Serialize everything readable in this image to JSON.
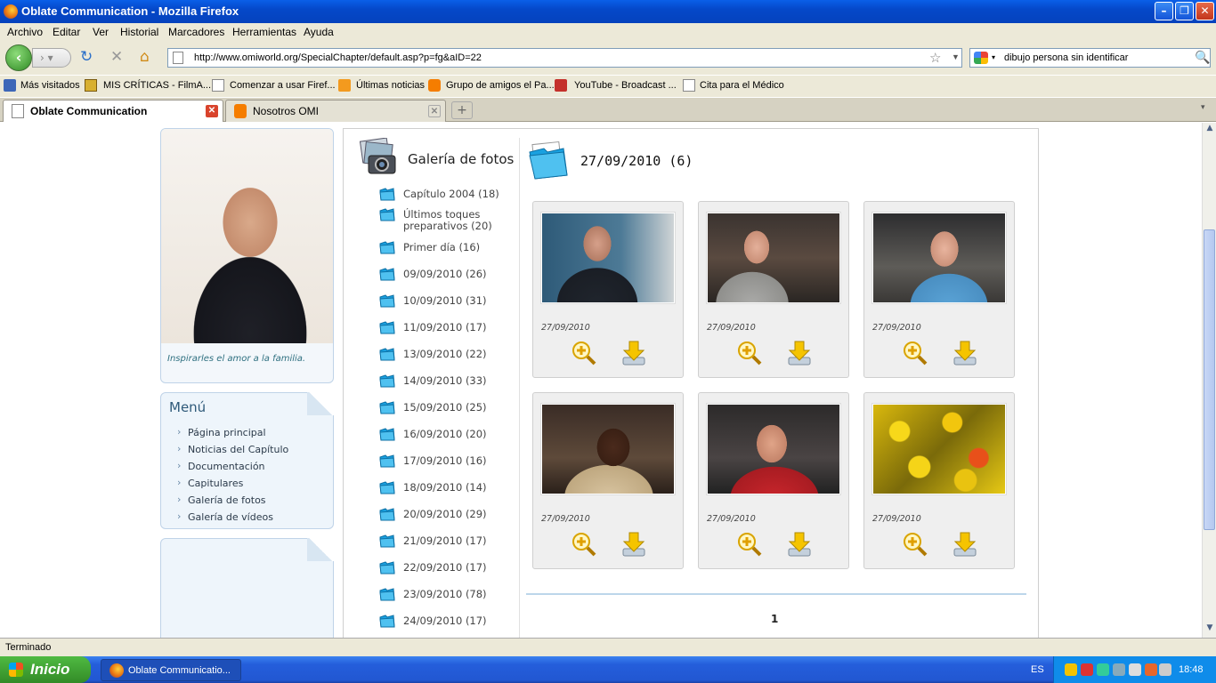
{
  "window": {
    "title": "Oblate Communication - Mozilla Firefox"
  },
  "menubar": [
    "Archivo",
    "Editar",
    "Ver",
    "Historial",
    "Marcadores",
    "Herramientas",
    "Ayuda"
  ],
  "navigation": {
    "url": "http://www.omiworld.org/SpecialChapter/default.asp?p=fg&aID=22",
    "search_value": "dibujo persona sin identificar"
  },
  "bookmarks": [
    "Más visitados",
    "MIS CRÍTICAS - FilmA...",
    "Comenzar a usar Firef...",
    "Últimas noticias",
    "Grupo de amigos el Pa...",
    "YouTube - Broadcast ...",
    "Cita para el Médico"
  ],
  "tabs": [
    {
      "label": "Oblate Communication"
    },
    {
      "label": "Nosotros OMI"
    }
  ],
  "status": "Terminado",
  "taskbar": {
    "start": "Inicio",
    "task": "Oblate Communicatio...",
    "lang": "ES",
    "clock": "18:48"
  },
  "page": {
    "portrait_caption": "Inspirarles el amor a la familia.",
    "menu": {
      "title": "Menú",
      "items": [
        "Página principal",
        "Noticias del Capítulo",
        "Documentación",
        "Capitulares",
        "Galería de fotos",
        "Galería de vídeos"
      ]
    },
    "gallery": {
      "title": "Galería de fotos",
      "albums": [
        "Capítulo 2004 (18)",
        "Últimos toques preparativos (20)",
        "Primer día (16)",
        "09/09/2010 (26)",
        "10/09/2010 (31)",
        "11/09/2010 (17)",
        "13/09/2010 (22)",
        "14/09/2010 (33)",
        "15/09/2010 (25)",
        "16/09/2010 (20)",
        "17/09/2010 (16)",
        "18/09/2010 (14)",
        "20/09/2010 (29)",
        "21/09/2010 (17)",
        "22/09/2010 (17)",
        "23/09/2010 (78)",
        "24/09/2010 (17)"
      ],
      "current_album": "27/09/2010 (6)",
      "photos": [
        {
          "date": "27/09/2010"
        },
        {
          "date": "27/09/2010"
        },
        {
          "date": "27/09/2010"
        },
        {
          "date": "27/09/2010"
        },
        {
          "date": "27/09/2010"
        },
        {
          "date": "27/09/2010"
        }
      ],
      "page": "1"
    }
  },
  "colors": {
    "title_bar": "#0548c9",
    "accent": "#2f5a7a",
    "folder": "#1aa1e0"
  }
}
